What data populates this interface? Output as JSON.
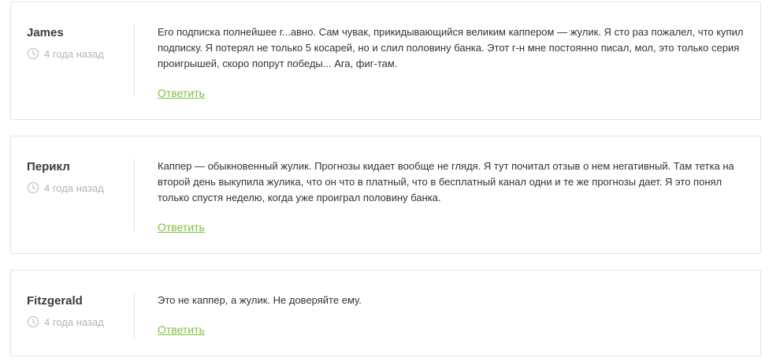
{
  "comments": [
    {
      "author": "James",
      "date": "4 года назад",
      "text": "Его подписка полнейшее г...авно. Сам чувак, прикидывающийся великим каппером — жулик. Я сто раз пожалел, что купил подписку. Я потерял не только 5 косарей, но и слил половину банка. Этот г-н мне постоянно писал, мол, это только серия проигрышей, скоро попрут победы... Ага, фиг-там.",
      "reply_label": "Ответить"
    },
    {
      "author": "Перикл",
      "date": "4 года назад",
      "text": "Каппер — обыкновенный жулик. Прогнозы кидает вообще не глядя. Я тут почитал отзыв о нем негативный. Там тетка на второй день выкупила жулика, что он что в платный, что в бесплатный канал одни и те же прогнозы дает. Я это понял только спустя неделю, когда уже проиграл половину банка.",
      "reply_label": "Ответить"
    },
    {
      "author": "Fitzgerald",
      "date": "4 года назад",
      "text": "Это не каппер, а жулик. Не доверяйте ему.",
      "reply_label": "Ответить"
    }
  ],
  "colors": {
    "accent": "#7cc242",
    "muted": "#b5b5b5",
    "text": "#333333",
    "border": "#e3e3e3"
  },
  "icons": {
    "date": "clock-icon"
  }
}
